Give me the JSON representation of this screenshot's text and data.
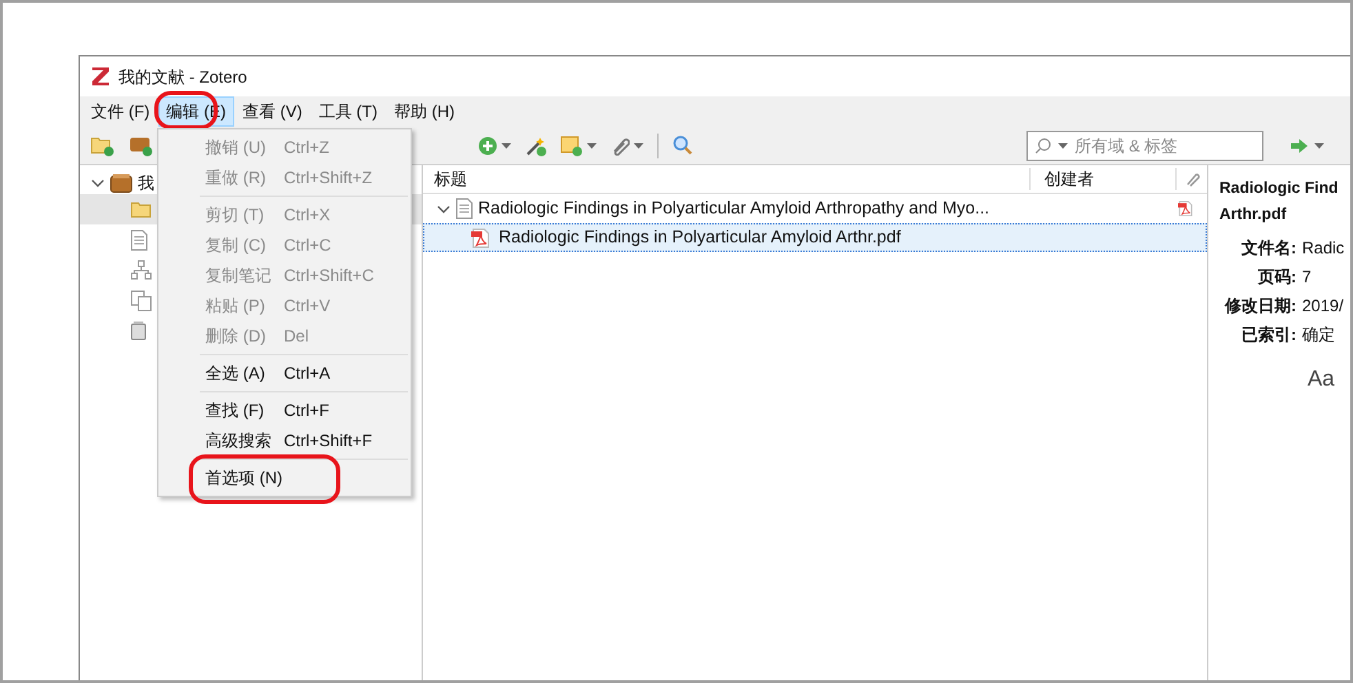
{
  "window": {
    "title": "我的文献 - Zotero"
  },
  "menu_bar": [
    {
      "label": "文件 (F)",
      "selected": false,
      "circled": false
    },
    {
      "label": "编辑 (E)",
      "selected": true,
      "circled": true
    },
    {
      "label": "查看 (V)",
      "selected": false,
      "circled": false
    },
    {
      "label": "工具 (T)",
      "selected": false,
      "circled": false
    },
    {
      "label": "帮助 (H)",
      "selected": false,
      "circled": false
    }
  ],
  "edit_menu": [
    {
      "kind": "item",
      "label": "撤销 (U)",
      "shortcut": "Ctrl+Z",
      "disabled": true,
      "circled": false
    },
    {
      "kind": "item",
      "label": "重做 (R)",
      "shortcut": "Ctrl+Shift+Z",
      "disabled": true,
      "circled": false
    },
    {
      "kind": "separator"
    },
    {
      "kind": "item",
      "label": "剪切 (T)",
      "shortcut": "Ctrl+X",
      "disabled": true,
      "circled": false
    },
    {
      "kind": "item",
      "label": "复制 (C)",
      "shortcut": "Ctrl+C",
      "disabled": true,
      "circled": false
    },
    {
      "kind": "item",
      "label": "复制笔记",
      "shortcut": "Ctrl+Shift+C",
      "disabled": true,
      "circled": false
    },
    {
      "kind": "item",
      "label": "粘贴 (P)",
      "shortcut": "Ctrl+V",
      "disabled": true,
      "circled": false
    },
    {
      "kind": "item",
      "label": "删除 (D)",
      "shortcut": "Del",
      "disabled": true,
      "circled": false
    },
    {
      "kind": "separator"
    },
    {
      "kind": "item",
      "label": "全选 (A)",
      "shortcut": "Ctrl+A",
      "disabled": false,
      "circled": false
    },
    {
      "kind": "separator"
    },
    {
      "kind": "item",
      "label": "查找 (F)",
      "shortcut": "Ctrl+F",
      "disabled": false,
      "circled": false
    },
    {
      "kind": "item",
      "label": "高级搜索",
      "shortcut": "Ctrl+Shift+F",
      "disabled": false,
      "circled": false
    },
    {
      "kind": "separator"
    },
    {
      "kind": "item",
      "label": "首选项 (N)",
      "disabled": false,
      "circled": true
    }
  ],
  "search": {
    "placeholder": "所有域 & 标签"
  },
  "collections": [
    {
      "label": "我",
      "kind": "library",
      "expanded": true,
      "selected": false,
      "children": [
        {
          "kind": "folder",
          "selected": true
        },
        {
          "kind": "document",
          "selected": false
        },
        {
          "kind": "hierarchy",
          "selected": false
        },
        {
          "kind": "duplicates",
          "selected": false
        },
        {
          "kind": "trash",
          "selected": false
        }
      ]
    }
  ],
  "items_table": {
    "columns": [
      "标题",
      "创建者"
    ],
    "rows": [
      {
        "title": "Radiologic Findings in Polyarticular Amyloid Arthropathy and Myo...",
        "kind": "document",
        "expanded": true,
        "selected": false,
        "has_pdf": true,
        "children": [
          {
            "title": "Radiologic Findings in Polyarticular Amyloid Arthr.pdf",
            "kind": "pdf",
            "selected": true,
            "has_pdf": false
          }
        ]
      }
    ]
  },
  "item_pane": {
    "title_lines": [
      "Radiologic Find",
      "Arthr.pdf"
    ],
    "fields": [
      {
        "label": "文件名:",
        "value": "Radic"
      },
      {
        "label": "页码:",
        "value": "7"
      },
      {
        "label": "修改日期:",
        "value": "2019/"
      },
      {
        "label": "已索引:",
        "value": "确定"
      }
    ],
    "font_button": "Aa"
  }
}
